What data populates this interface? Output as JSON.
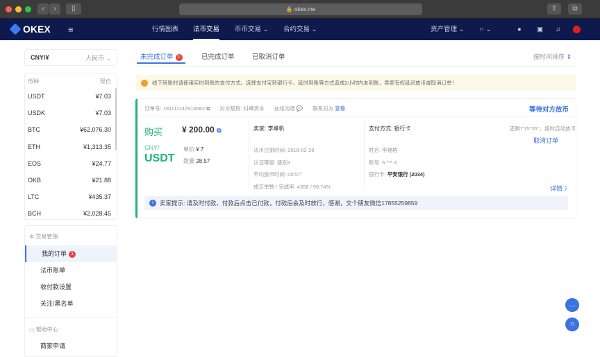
{
  "browser": {
    "url": "okex.me"
  },
  "nav": {
    "logo": "OKEX",
    "items": [
      "行情图表",
      "法币交易",
      "币币交易",
      "合约交易"
    ],
    "assets": "资产管理"
  },
  "sidebar": {
    "currency": "CNY/¥",
    "currency_hint": "人民币",
    "col_coin": "币种",
    "col_price": "现价",
    "coins": [
      {
        "name": "USDT",
        "price": "¥7.03"
      },
      {
        "name": "USDK",
        "price": "¥7.03"
      },
      {
        "name": "BTC",
        "price": "¥62,076.30"
      },
      {
        "name": "ETH",
        "price": "¥1,313.35"
      },
      {
        "name": "EOS",
        "price": "¥24.77"
      },
      {
        "name": "OKB",
        "price": "¥21.88"
      },
      {
        "name": "LTC",
        "price": "¥435.37"
      },
      {
        "name": "BCH",
        "price": "¥2,028.45"
      }
    ],
    "section_trade": "交易管理",
    "menu": [
      "我的订单",
      "法币账单",
      "收付款设置",
      "关注/黑名单"
    ],
    "order_badge": "1",
    "section_help": "帮助中心",
    "help_menu": [
      "商家申请"
    ]
  },
  "tabs": {
    "items": [
      "未完成订单",
      "已完成订单",
      "已取消订单"
    ],
    "badge": "1",
    "sort": "按时间排序"
  },
  "notice": "线下转账时请使用实时到账的支付方式。选择支付宝转银行卡、延时到账等方式造成2小时内未到账，卖家有权延迟放币或取消订单！",
  "order": {
    "id_label": "订单号:",
    "id": "191111142916582",
    "peer_label": "对方昵称:",
    "peer": "抖峰资本",
    "chat": "在线沟通",
    "contact_label": "联系对方",
    "contact_link": "查看",
    "status": "等待对方放币",
    "side": "购买",
    "amount": "¥ 200.00",
    "pair_top": "CNY/",
    "pair_bottom": "USDT",
    "unit_label": "单价",
    "unit": "¥ 7",
    "qty_label": "数量",
    "qty": "28.57",
    "seller_label": "卖家:",
    "seller": "李峰帆",
    "reg": "法币注册时间: 2018-02-28",
    "level": "认证等级: 级别3",
    "avg": "平均放币时间: 00'57\"",
    "deals": "成交单数 / 完成率: 4358 / 99.74%",
    "pay_label": "支付方式:",
    "pay": "银行卡",
    "name": "姓名: 李福梧",
    "acct": "账号: 6 *** 4",
    "bank_label": "银行卡:",
    "bank": "平安银行 (2034)",
    "countdown": "还剩7'15\"35\"，超时自动放币",
    "cancel": "取消订单",
    "details": "详情 〉",
    "tip": "卖家提示: 请及时付款，付款后点击已付款，付款后会及时放行，感谢，交个朋友微信17855259859"
  }
}
